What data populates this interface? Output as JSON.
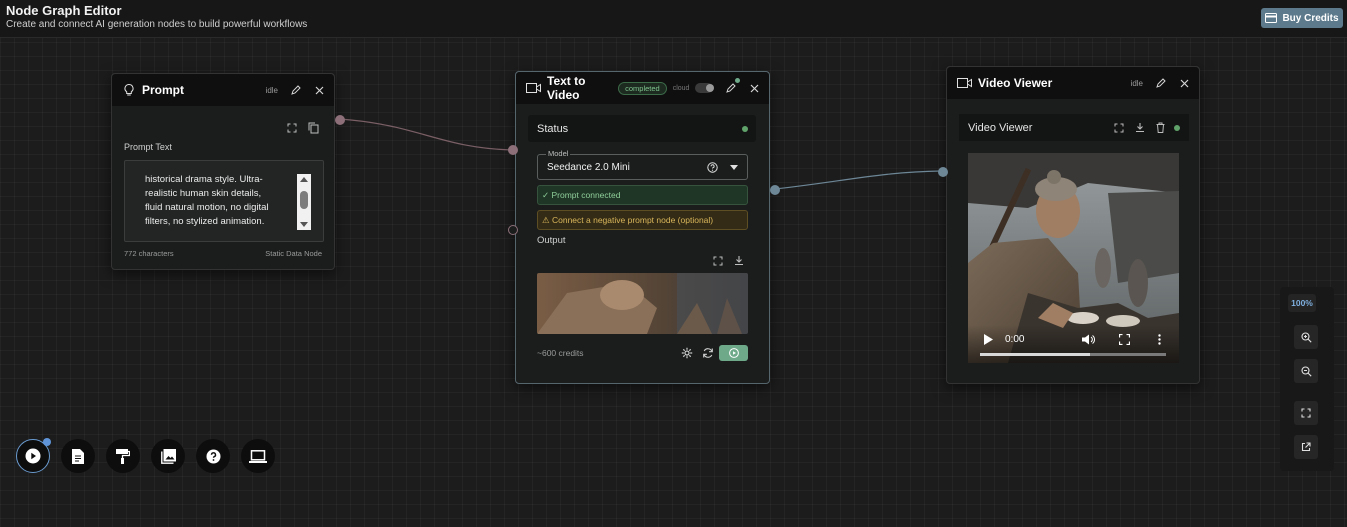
{
  "header": {
    "title": "Node Graph Editor",
    "subtitle": "Create and connect AI generation nodes to build powerful workflows",
    "buy_credits_label": "Buy Credits"
  },
  "prompt_node": {
    "title": "Prompt",
    "status": "idle",
    "field_label": "Prompt Text",
    "text": "historical drama style. Ultra-realistic human skin details, fluid natural motion, no digital filters, no stylized animation.",
    "char_count": "772 characters",
    "node_kind": "Static Data Node"
  },
  "t2v_node": {
    "title": "Text to Video",
    "status_badge": "completed",
    "cloud_label": "cloud",
    "status_section": "Status",
    "model_legend": "Model",
    "model_value": "Seedance 2.0 Mini",
    "prompt_connected": "✓ Prompt connected",
    "negative_prompt_hint": "⚠ Connect a negative prompt node (optional)",
    "output_label": "Output",
    "credits": "~600 credits"
  },
  "viewer_node": {
    "title": "Video Viewer",
    "status": "idle",
    "section_title": "Video Viewer",
    "time": "0:00",
    "progress": 0.59
  },
  "zoom": {
    "level": "100%"
  },
  "toolbar": {
    "items": [
      "play-icon",
      "document-icon",
      "paint-roller-icon",
      "gallery-icon",
      "help-icon",
      "laptop-icon"
    ]
  },
  "colors": {
    "accent_blue": "#5f95d8",
    "success_green": "#6ea98a",
    "warning_amber": "#d9b65c",
    "buy_button": "#5d7a8c"
  }
}
